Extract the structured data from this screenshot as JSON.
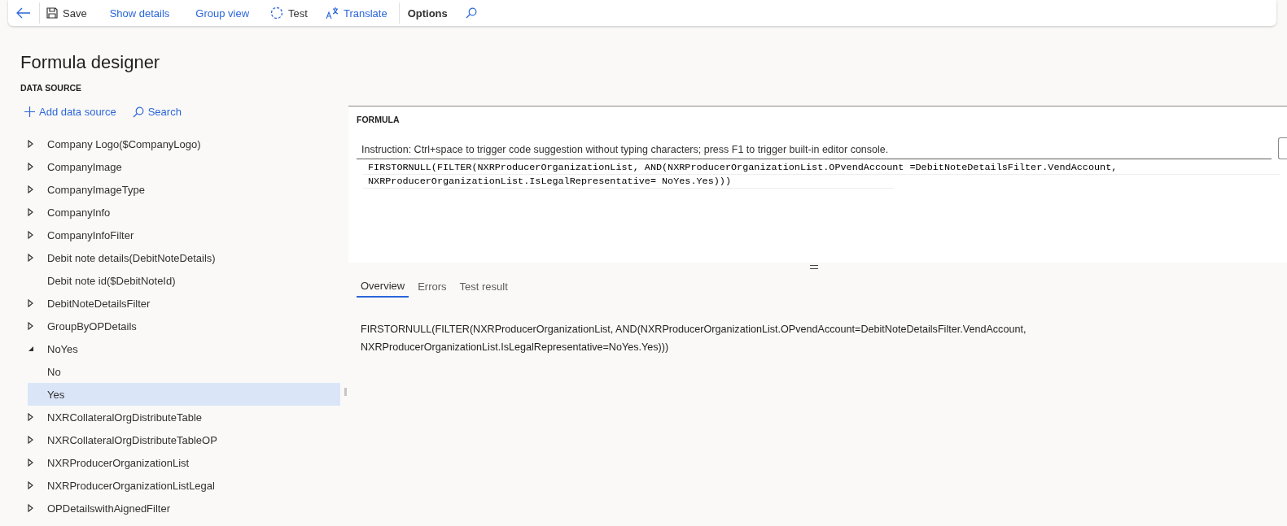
{
  "toolbar": [
    {
      "kind": "back"
    },
    {
      "kind": "save",
      "label": "Save"
    },
    {
      "kind": "link",
      "label": "Show details"
    },
    {
      "kind": "link",
      "label": "Group view"
    },
    {
      "kind": "test",
      "label": "Test"
    },
    {
      "kind": "translate",
      "label": "Translate"
    },
    {
      "kind": "divider"
    },
    {
      "kind": "menu",
      "label": "Options"
    },
    {
      "kind": "search"
    }
  ],
  "page_title": "Formula designer",
  "data_source": {
    "heading": "DATA SOURCE",
    "actions": [
      {
        "kind": "add",
        "label": "Add data source"
      },
      {
        "kind": "search",
        "label": "Search"
      }
    ],
    "tree": [
      {
        "label": "Company Logo($CompanyLogo)",
        "kind": "node",
        "expanded": false,
        "selected": false
      },
      {
        "label": "CompanyImage",
        "kind": "node",
        "expanded": false,
        "selected": false
      },
      {
        "label": "CompanyImageType",
        "kind": "node",
        "expanded": false,
        "selected": false
      },
      {
        "label": "CompanyInfo",
        "kind": "node",
        "expanded": false,
        "selected": false
      },
      {
        "label": "CompanyInfoFilter",
        "kind": "node",
        "expanded": false,
        "selected": false
      },
      {
        "label": "Debit note details(DebitNoteDetails)",
        "kind": "node",
        "expanded": false,
        "selected": false
      },
      {
        "label": "Debit note id($DebitNoteId)",
        "kind": "leaf",
        "selected": false
      },
      {
        "label": "DebitNoteDetailsFilter",
        "kind": "node",
        "expanded": false,
        "selected": false
      },
      {
        "label": "GroupByOPDetails",
        "kind": "node",
        "expanded": false,
        "selected": false
      },
      {
        "label": "NoYes",
        "kind": "node",
        "expanded": true,
        "selected": false,
        "children": [
          {
            "label": "No",
            "kind": "leaf",
            "selected": false
          },
          {
            "label": "Yes",
            "kind": "leaf",
            "selected": true
          }
        ]
      },
      {
        "label": "NXRCollateralOrgDistributeTable",
        "kind": "node",
        "expanded": false,
        "selected": false
      },
      {
        "label": "NXRCollateralOrgDistributeTableOP",
        "kind": "node",
        "expanded": false,
        "selected": false
      },
      {
        "label": "NXRProducerOrganizationList",
        "kind": "node",
        "expanded": false,
        "selected": false
      },
      {
        "label": "NXRProducerOrganizationListLegal",
        "kind": "node",
        "expanded": false,
        "selected": false
      },
      {
        "label": "OPDetailswithAignedFilter",
        "kind": "node",
        "expanded": false,
        "selected": false
      }
    ]
  },
  "formula": {
    "heading": "FORMULA",
    "instruction": "Instruction: Ctrl+space to trigger code suggestion without typing characters; press F1 to trigger built-in editor console.",
    "code_lines": [
      "FIRSTORNULL(FILTER(NXRProducerOrganizationList, AND(NXRProducerOrganizationList.OPvendAccount =DebitNoteDetailsFilter.VendAccount,",
      "NXRProducerOrganizationList.IsLegalRepresentative= NoYes.Yes)))"
    ]
  },
  "tabs": [
    {
      "label": "Overview",
      "selected": true
    },
    {
      "label": "Errors",
      "selected": false
    },
    {
      "label": "Test result",
      "selected": false
    }
  ],
  "overview_lines": [
    "FIRSTORNULL(FILTER(NXRProducerOrganizationList, AND(NXRProducerOrganizationList.OPvendAccount=DebitNoteDetailsFilter.VendAccount,",
    "NXRProducerOrganizationList.IsLegalRepresentative=NoYes.Yes)))"
  ]
}
